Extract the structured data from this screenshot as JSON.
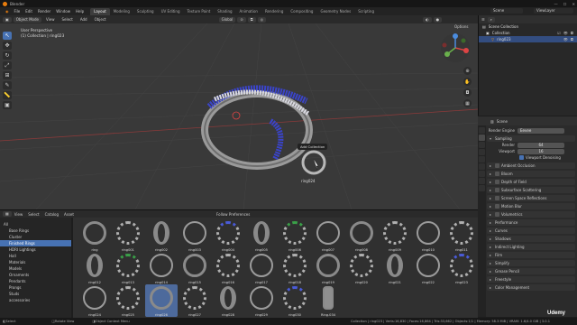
{
  "app": {
    "title": "Blender",
    "win_min": "—",
    "win_max": "☐",
    "win_close": "✕"
  },
  "topbar": {
    "menus": [
      "File",
      "Edit",
      "Render",
      "Window",
      "Help"
    ],
    "workspaces": [
      "Layout",
      "Modeling",
      "Sculpting",
      "UV Editing",
      "Texture Paint",
      "Shading",
      "Animation",
      "Rendering",
      "Compositing",
      "Geometry Nodes",
      "Scripting"
    ],
    "active_workspace": "Layout",
    "scene": "Scene",
    "view_layer": "ViewLayer"
  },
  "viewport_header": {
    "mode": "Object Mode",
    "menus": [
      "View",
      "Select",
      "Add",
      "Object"
    ],
    "orientation": "Global",
    "options": "Options"
  },
  "viewport": {
    "info_line1": "User Perspective",
    "info_line2": "(1) Collection | ring023",
    "popup_label": "Add Collection",
    "object_label": "ring024"
  },
  "toolbar": {
    "icons": [
      "cursor-select-icon",
      "move-icon",
      "rotate-icon",
      "scale-icon",
      "transform-icon",
      "annotate-icon",
      "measure-icon",
      "add-cube-icon"
    ]
  },
  "outliner": {
    "root": "Scene Collection",
    "collection": "Collection",
    "object": "ring023"
  },
  "properties": {
    "header": "Scene",
    "render_engine_label": "Render Engine",
    "render_engine": "Eevee",
    "sampling": "Sampling",
    "render_label": "Render",
    "render_value": "64",
    "viewport_label": "Viewport",
    "viewport_value": "16",
    "viewport_denoising": "Viewport Denoising",
    "panels": [
      "Ambient Occlusion",
      "Bloom",
      "Depth of Field",
      "Subsurface Scattering",
      "Screen Space Reflections",
      "Motion Blur",
      "Volumetrics",
      "Performance",
      "Curves",
      "Shadows",
      "Indirect Lighting",
      "Film",
      "Simplify",
      "Grease Pencil",
      "Freestyle",
      "Color Management"
    ]
  },
  "asset_browser": {
    "menus": [
      "View",
      "Select",
      "Catalog",
      "Asset"
    ],
    "filter": "Follow Preferences",
    "categories": [
      {
        "label": "All",
        "level": 0
      },
      {
        "label": "Base Rings",
        "level": 1
      },
      {
        "label": "Cluster",
        "level": 1
      },
      {
        "label": "Finished Rings",
        "level": 1,
        "selected": true
      },
      {
        "label": "HDRI Lightings",
        "level": 1
      },
      {
        "label": "Hall",
        "level": 1
      },
      {
        "label": "Materials",
        "level": 1
      },
      {
        "label": "Models",
        "level": 1
      },
      {
        "label": "Ornaments",
        "level": 1
      },
      {
        "label": "Pendants",
        "level": 1
      },
      {
        "label": "Prongs",
        "level": 1
      },
      {
        "label": "Studs",
        "level": 1
      },
      {
        "label": "accessories",
        "level": 1
      }
    ],
    "rows": [
      [
        "ring",
        "ring001",
        "ring002",
        "ring003",
        "ring004",
        "ring005",
        "ring006",
        "ring007",
        "ring008",
        "ring009",
        "ring010",
        "ring011"
      ],
      [
        "ring012",
        "ring013",
        "ring014",
        "ring015",
        "ring016",
        "ring017",
        "ring018",
        "ring019",
        "ring020",
        "ring021",
        "ring022",
        "ring023"
      ],
      [
        "ring024",
        "ring025",
        "ring026",
        "ring027",
        "ring028",
        "ring029",
        "ring030",
        "Ring.034"
      ]
    ],
    "selected_asset": "ring026"
  },
  "statusbar": {
    "left": "Select",
    "mid1": "Rotate View",
    "mid2": "Object Context Menu",
    "right": "Collection | ring023 | Verts:16,830 | Faces:16,864 | Tris:33,662 | Objects:1/1 | Memory: 58.3 MiB | VRAM: 1.6/4.0 GiB | 3.0.1"
  },
  "watermark": "Udemy",
  "colors": {
    "accent": "#4772b3",
    "brand": "#e87d0d",
    "gem_blue": "#3a44c8"
  }
}
